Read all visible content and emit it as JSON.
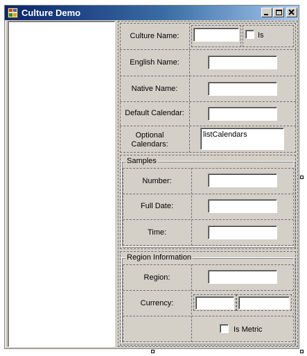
{
  "window": {
    "title": "Culture Demo"
  },
  "culture": {
    "culture_name_label": "Culture Name:",
    "is_label": "Is",
    "english_name_label": "English Name:",
    "native_name_label": "Native Name:",
    "default_calendar_label": "Default Calendar:",
    "optional_calendars_label_1": "Optional",
    "optional_calendars_label_2": "Calendars:",
    "list_calendars_text": "listCalendars"
  },
  "samples": {
    "group_title": "Samples",
    "number_label": "Number:",
    "full_date_label": "Full Date:",
    "time_label": "Time:"
  },
  "region": {
    "group_title": "Region Information",
    "region_label": "Region:",
    "currency_label": "Currency:",
    "is_metric_label": "Is Metric"
  }
}
